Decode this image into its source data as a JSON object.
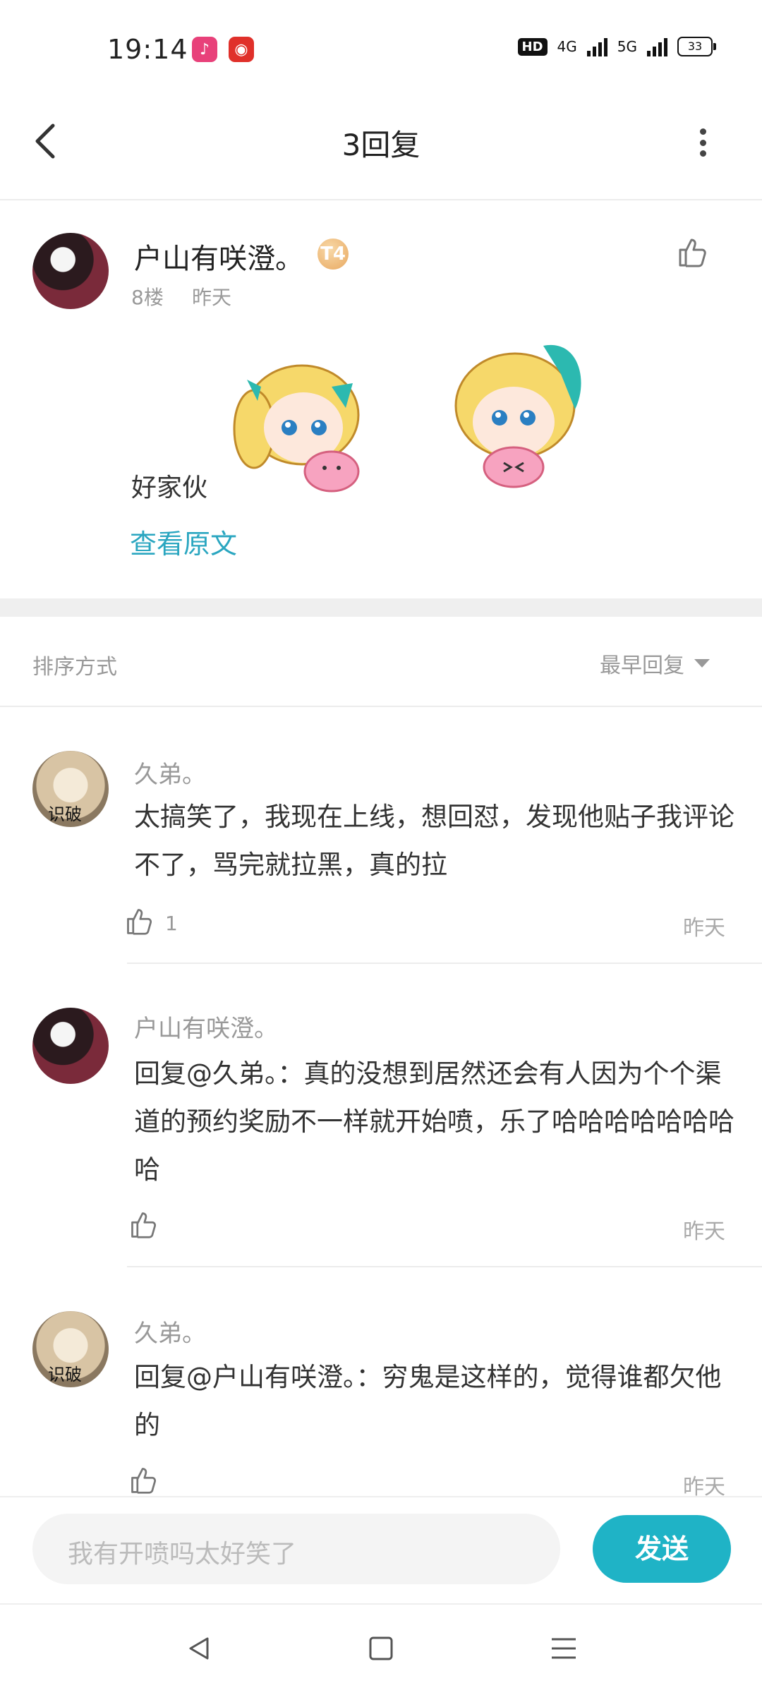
{
  "status_bar": {
    "time": "19:14",
    "hd": "HD",
    "net1": "4G",
    "net2": "5G",
    "battery": "33",
    "app_icons": [
      "music-app-icon",
      "netease-music-icon"
    ]
  },
  "header": {
    "title": "3回复"
  },
  "post": {
    "username": "户山有咲澄。",
    "badge": "T4",
    "floor": "8楼",
    "time": "昨天",
    "text": "好家伙",
    "view_original": "查看原文"
  },
  "sort": {
    "label": "排序方式",
    "value": "最早回复"
  },
  "comments": [
    {
      "name": "久弟。",
      "text": "太搞笑了，我现在上线，想回怼，发现他贴子我评论不了，骂完就拉黑，真的拉",
      "likes": "1",
      "time": "昨天",
      "avatar": "cat"
    },
    {
      "name": "户山有咲澄。",
      "text": "回复@久弟。：真的没想到居然还会有人因为个个渠道的预约奖励不一样就开始喷，乐了哈哈哈哈哈哈哈哈",
      "likes": "",
      "time": "昨天",
      "avatar": "dark"
    },
    {
      "name": "久弟。",
      "text": "回复@户山有咲澄。：穷鬼是这样的，觉得谁都欠他的",
      "likes": "",
      "time": "昨天",
      "avatar": "cat"
    }
  ],
  "avatar_label": "识破",
  "input": {
    "placeholder": "我有开喷吗太好笑了",
    "send": "发送"
  },
  "colors": {
    "accent": "#1fb3c6",
    "link": "#2aa6c0"
  }
}
